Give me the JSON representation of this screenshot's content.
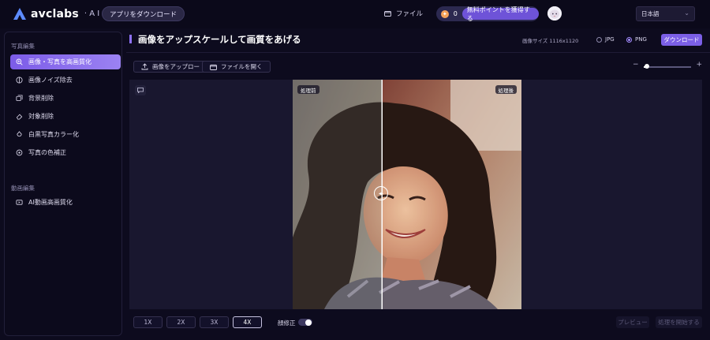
{
  "colors": {
    "accent": "#7b5fe6",
    "background": "#0d0b1e",
    "canvas": "#19172f"
  },
  "header": {
    "brand": "avclabs",
    "brand_suffix": "· A I",
    "download_app": "アプリをダウンロード",
    "file_menu": "ファイル",
    "points_count": "0",
    "free_points": "無料ポイントを獲得する",
    "language": "日本語"
  },
  "sidebar": {
    "photo_heading": "写真編集",
    "photo_items": [
      {
        "label": "画像・写真を高画質化",
        "icon": "magnify-icon",
        "active": true
      },
      {
        "label": "画像ノイズ除去",
        "icon": "noise-icon",
        "active": false
      },
      {
        "label": "背景削除",
        "icon": "background-icon",
        "active": false
      },
      {
        "label": "対象削除",
        "icon": "eraser-icon",
        "active": false
      },
      {
        "label": "白黒写真カラー化",
        "icon": "palette-icon",
        "active": false
      },
      {
        "label": "写真の色補正",
        "icon": "color-correct-icon",
        "active": false
      }
    ],
    "video_heading": "動画編集",
    "video_items": [
      {
        "label": "AI動画高画質化",
        "icon": "video-enhance-icon",
        "active": false
      }
    ]
  },
  "main": {
    "title": "画像をアップスケールして画質をあげる",
    "image_size": "画像サイズ 1116x1120",
    "formats": {
      "jpg": "JPG",
      "png": "PNG",
      "selected": "PNG"
    },
    "download": "ダウンロード",
    "upload_image": "画像をアップロー",
    "open_file": "ファイルを開く",
    "zoom_level": 0.05,
    "before_label": "処理前",
    "after_label": "処理後",
    "scales": [
      "1X",
      "2X",
      "3X",
      "4X"
    ],
    "selected_scale": "4X",
    "color_fix_label": "顔修正",
    "color_fix_on": true,
    "preview": "プレビュー",
    "start": "処理を開始する"
  }
}
